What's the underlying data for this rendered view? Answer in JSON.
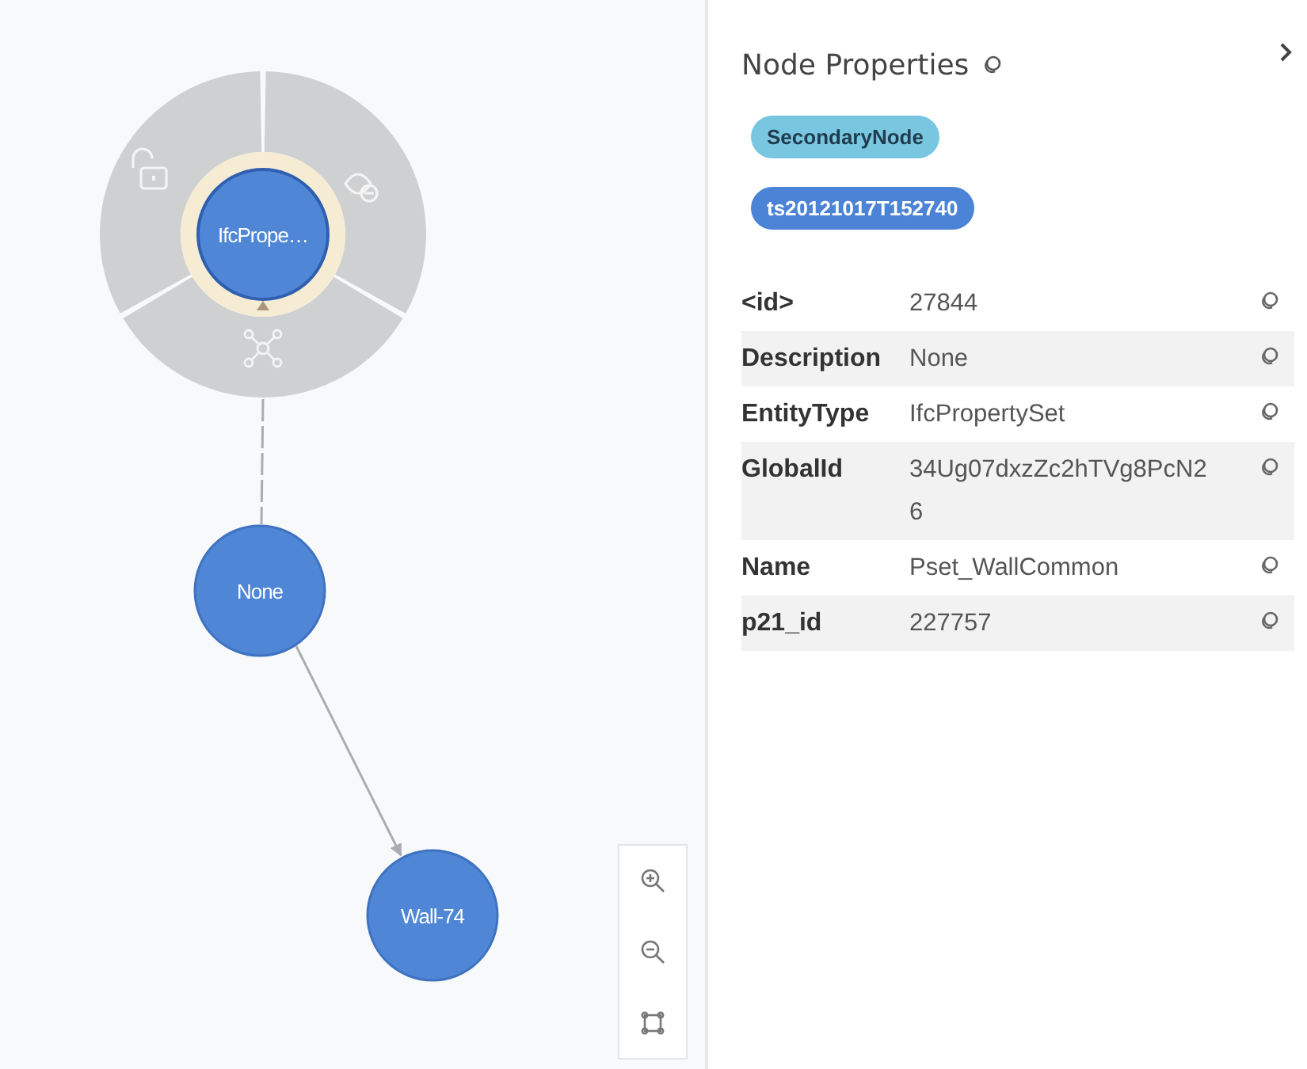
{
  "graph": {
    "nodes": [
      {
        "label": "IfcPrope…",
        "selected": true
      },
      {
        "label": "None",
        "selected": false
      },
      {
        "label": "Wall-74",
        "selected": false
      }
    ]
  },
  "panel": {
    "title": "Node Properties",
    "badges": [
      {
        "text": "SecondaryNode",
        "kind": "label"
      },
      {
        "text": "ts20121017T152740",
        "kind": "property"
      }
    ],
    "properties": [
      {
        "key": "<id>",
        "value": "27844"
      },
      {
        "key": "Description",
        "value": "None"
      },
      {
        "key": "EntityType",
        "value": "IfcPropertySet"
      },
      {
        "key": "GlobalId",
        "value": "34Ug07dxzZc2hTVg8PcN26"
      },
      {
        "key": "Name",
        "value": "Pset_WallCommon"
      },
      {
        "key": "p21_id",
        "value": "227757"
      }
    ]
  }
}
